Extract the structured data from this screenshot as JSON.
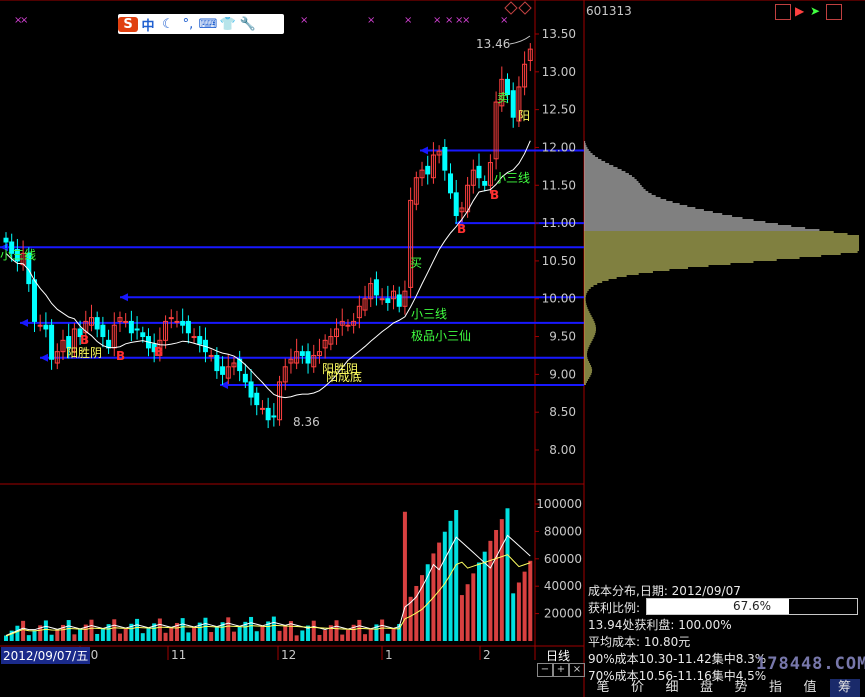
{
  "stock_code": "601313",
  "ime_toolbar": {
    "logo": "S",
    "lang": "中",
    "icons": [
      "moon-icon",
      "punct-icon",
      "keyboard-icon",
      "skin-icon",
      "wrench-icon"
    ]
  },
  "price_axis": {
    "ticks": [
      "13.50",
      "13.00",
      "12.50",
      "12.00",
      "11.50",
      "11.00",
      "10.50",
      "10.00",
      "9.50",
      "9.00",
      "8.50",
      "8.00"
    ]
  },
  "volume_axis": {
    "ticks": [
      "100000",
      "80000",
      "60000",
      "40000",
      "20000"
    ]
  },
  "date_axis": {
    "current_date": "2012/09/07/五",
    "month_labels": [
      "10",
      "11",
      "12",
      "1",
      "2"
    ]
  },
  "period_label": "日线",
  "annotations": {
    "high": "13.46",
    "low": "8.36",
    "texts": [
      "阳胜阴",
      "阳胜阴",
      "阳成底",
      "小三线",
      "极品小三仙",
      "买",
      "小三线",
      "阳",
      "卖"
    ],
    "markers": [
      "B",
      "B",
      "B",
      "B",
      "B"
    ]
  },
  "cost_panel": {
    "title": "成本分布,日期: 2012/09/07",
    "profit_label": "获利比例:",
    "profit_value": "67.6%",
    "profit_fraction": 0.676,
    "profit_at": "13.94处获利盘: 100.00%",
    "avg_cost": "平均成本: 10.80元",
    "range90": "90%成本10.30-11.42集中8.3%",
    "range70": "70%成本10.56-11.16集中4.5%"
  },
  "watermark": "178448.COM",
  "bottom_tabs": [
    "笔",
    "价",
    "细",
    "盘",
    "势",
    "指",
    "值",
    "筹"
  ],
  "colors": {
    "up": "#ff4040",
    "down": "#00ffff",
    "ma": "#ffffff",
    "level_line": "#0000ff",
    "volume_up": "#d84040",
    "volume_down": "#00e0e0",
    "cost_dist": "#ffffff",
    "cost_dist_low": "#ffff80"
  }
}
